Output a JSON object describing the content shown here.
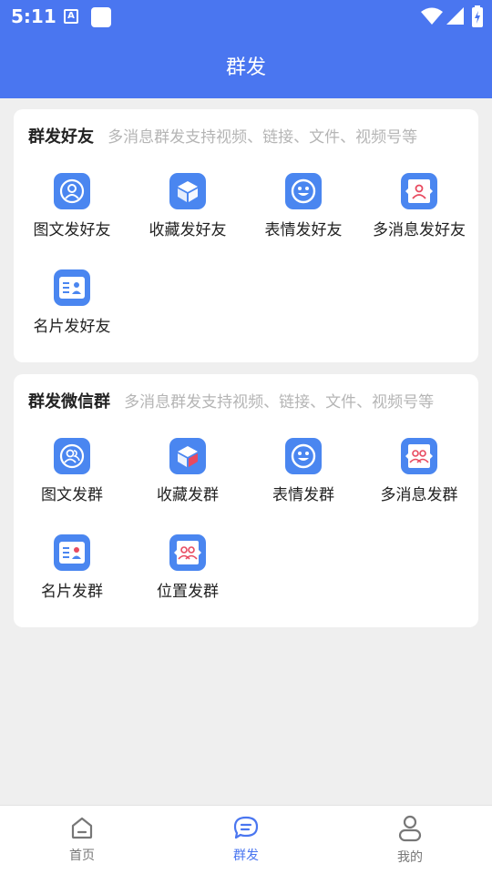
{
  "status_bar": {
    "time": "5:11",
    "a_icon": "A"
  },
  "header": {
    "title": "群发"
  },
  "friends": {
    "title": "群发好友",
    "subtitle": "多消息群发支持视频、链接、文件、视频号等",
    "items": [
      {
        "label": "图文发好友",
        "icon": "contact-icon"
      },
      {
        "label": "收藏发好友",
        "icon": "cube-icon"
      },
      {
        "label": "表情发好友",
        "icon": "smiley-icon"
      },
      {
        "label": "多消息发好友",
        "icon": "chat-person-icon"
      },
      {
        "label": "名片发好友",
        "icon": "card-icon"
      }
    ]
  },
  "groups": {
    "title": "群发微信群",
    "subtitle": "多消息群发支持视频、链接、文件、视频号等",
    "items": [
      {
        "label": "图文发群",
        "icon": "group-contact-icon"
      },
      {
        "label": "收藏发群",
        "icon": "cube-icon"
      },
      {
        "label": "表情发群",
        "icon": "smiley-icon"
      },
      {
        "label": "多消息发群",
        "icon": "chat-group-icon"
      },
      {
        "label": "名片发群",
        "icon": "card-icon"
      },
      {
        "label": "位置发群",
        "icon": "location-group-icon"
      }
    ]
  },
  "tabbar": {
    "tabs": [
      {
        "label": "首页",
        "icon": "home-icon"
      },
      {
        "label": "群发",
        "icon": "chat-icon",
        "active": true
      },
      {
        "label": "我的",
        "icon": "person-icon"
      }
    ]
  },
  "colors": {
    "primary": "#4a76f0",
    "icon_bg": "#4a86f0",
    "accent_red": "#e84a5f",
    "background": "#efefef"
  }
}
